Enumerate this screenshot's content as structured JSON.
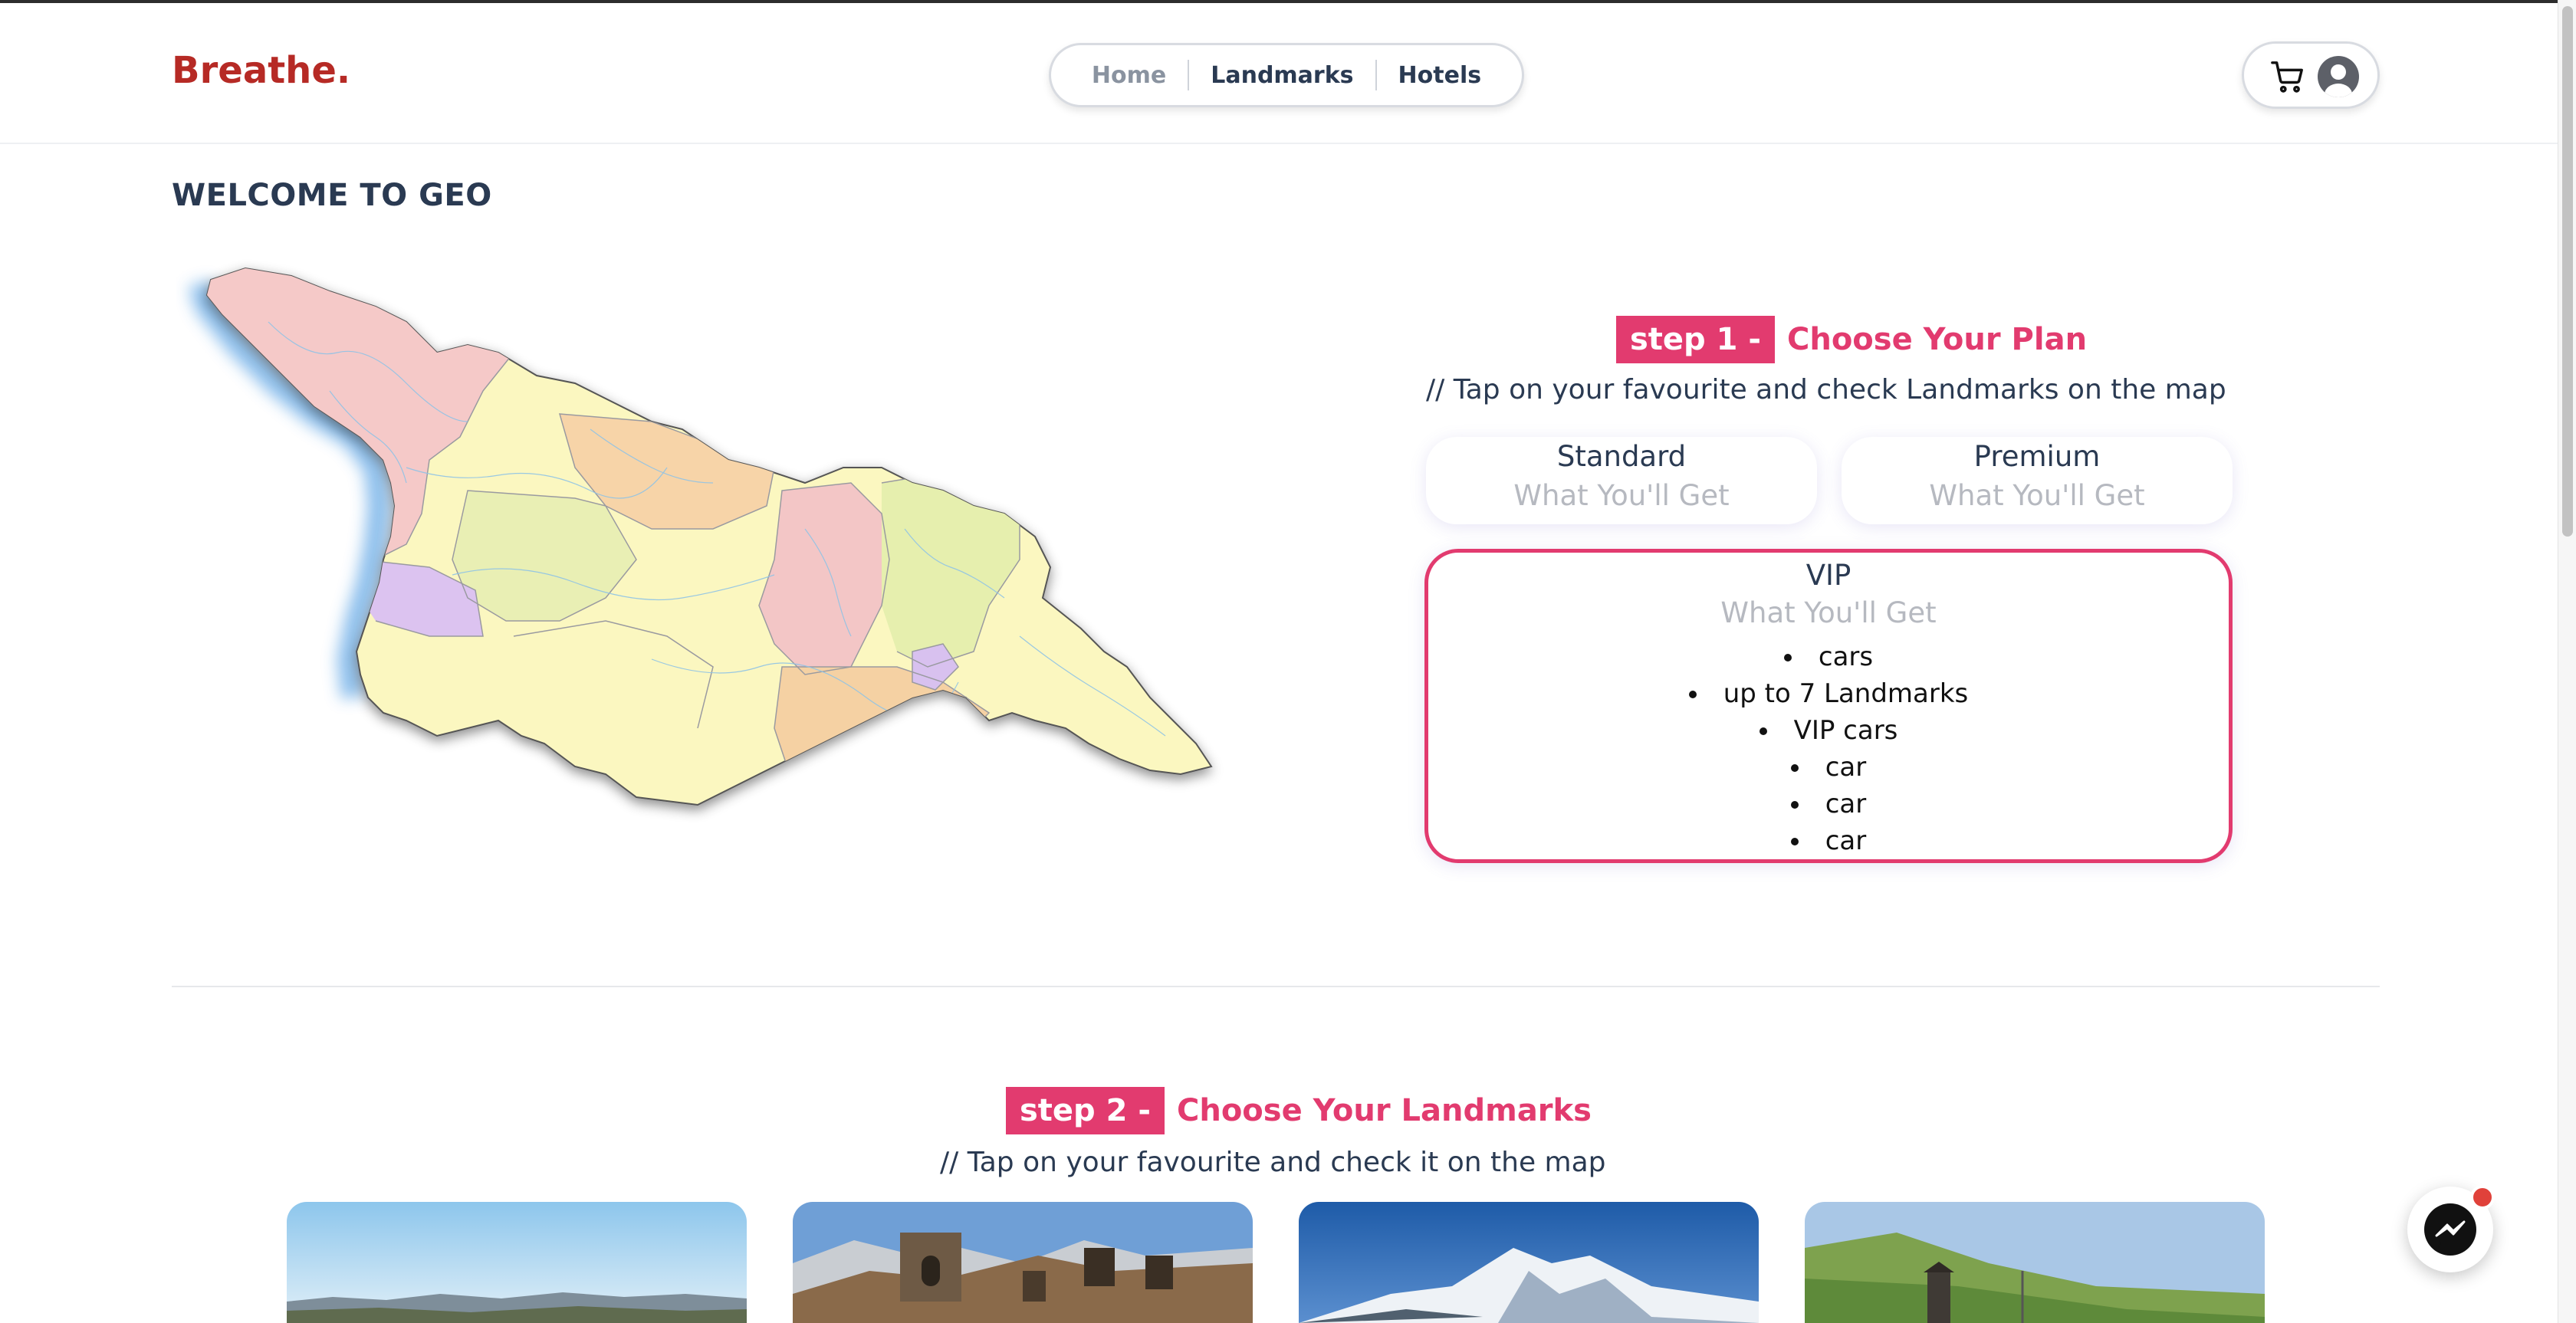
{
  "header": {
    "logo": "Breathe.",
    "nav": [
      {
        "label": "Home",
        "active": false
      },
      {
        "label": "Landmarks",
        "active": true
      },
      {
        "label": "Hotels",
        "active": true
      }
    ],
    "icons": [
      "cart-icon",
      "user-avatar-icon"
    ]
  },
  "welcome_title": "WELCOME TO GEO",
  "step1": {
    "badge": "step 1 -",
    "title": "Choose Your Plan",
    "hint": "// Tap on your favourite and check Landmarks on the map"
  },
  "plans": {
    "standard": {
      "name": "Standard",
      "subtitle": "What You'll Get"
    },
    "premium": {
      "name": "Premium",
      "subtitle": "What You'll Get"
    },
    "vip": {
      "name": "VIP",
      "subtitle": "What You'll Get",
      "features": [
        "cars",
        "up to 7 Landmarks",
        "VIP cars",
        "car",
        "car",
        "car"
      ]
    }
  },
  "step2": {
    "badge": "step 2 -",
    "title": "Choose Your Landmarks",
    "hint": "// Tap on your favourite and check it on the map"
  },
  "colors": {
    "brand": "#b62a25",
    "accent": "#e23b6f",
    "text": "#2a3a52",
    "notification": "#e0413a"
  },
  "chat_button_icon": "messenger-icon"
}
